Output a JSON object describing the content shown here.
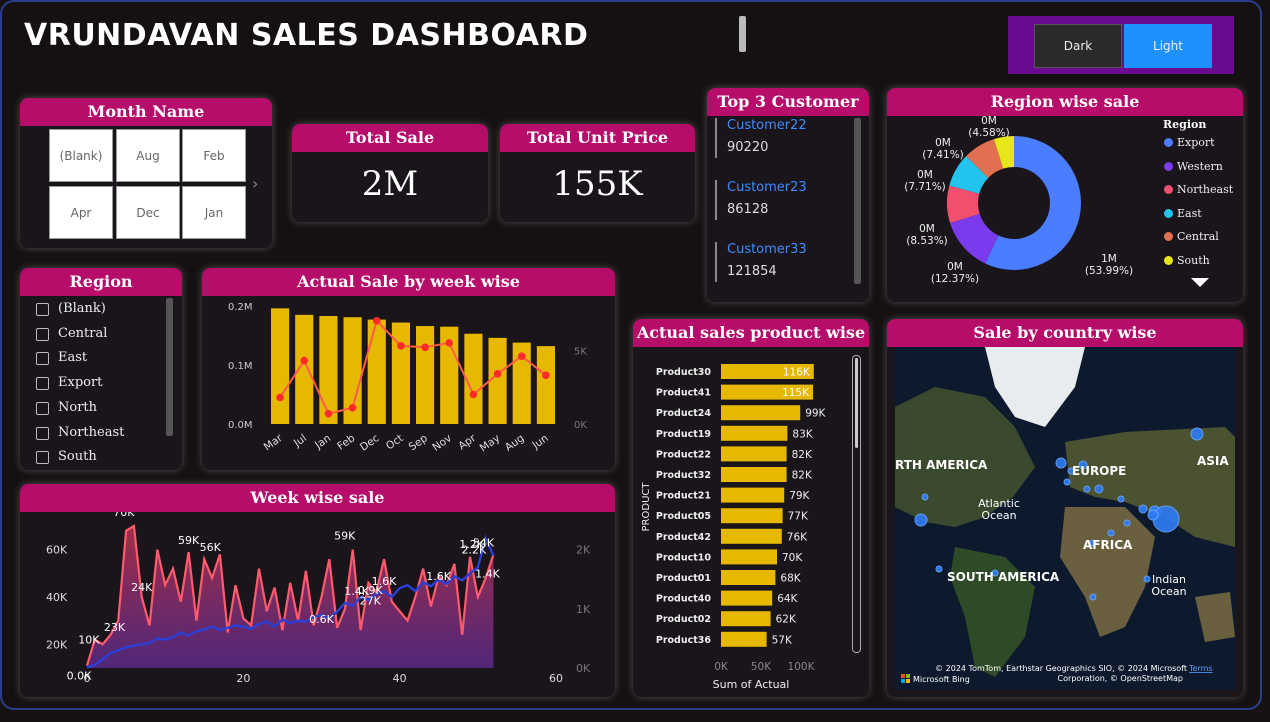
{
  "header": {
    "title": "VRUNDAVAN SALES DASHBOARD"
  },
  "theme_switch": {
    "dark_label": "Dark",
    "light_label": "Light",
    "active": "Light",
    "accent": "#1e90ff",
    "panel_color": "#6a0b8f"
  },
  "colors": {
    "card_title": "#b50d69",
    "bar": "#e6b800",
    "line": "#ff4d4d",
    "accent_blue": "#3d8cff"
  },
  "month_slicer": {
    "title": "Month Name",
    "tiles": [
      "(Blank)",
      "Aug",
      "Feb",
      "Apr",
      "Dec",
      "Jan"
    ]
  },
  "total_sale": {
    "title": "Total Sale",
    "value": "2M"
  },
  "total_unit_price": {
    "title": "Total Unit Price",
    "value": "155K"
  },
  "top_customers": {
    "title": "Top 3 Customer",
    "items": [
      {
        "name": "Customer22",
        "value": "90220"
      },
      {
        "name": "Customer23",
        "value": "86128"
      },
      {
        "name": "Customer33",
        "value": "121854"
      }
    ]
  },
  "region_slicer": {
    "title": "Region",
    "items": [
      "(Blank)",
      "Central",
      "East",
      "Export",
      "North",
      "Northeast",
      "South"
    ]
  },
  "region_wise": {
    "title": "Region wise sale",
    "legend_title": "Region",
    "legend": [
      {
        "name": "Export",
        "color": "#4a7dff"
      },
      {
        "name": "Western",
        "color": "#7c3aed"
      },
      {
        "name": "Northeast",
        "color": "#f0506e"
      },
      {
        "name": "East",
        "color": "#22c4ee"
      },
      {
        "name": "Central",
        "color": "#e07050"
      },
      {
        "name": "South",
        "color": "#e6e619"
      }
    ],
    "labels": [
      {
        "value": "1M",
        "pct": "(53.99%)"
      },
      {
        "value": "0M",
        "pct": "(12.37%)"
      },
      {
        "value": "0M",
        "pct": "(8.53%)"
      },
      {
        "value": "0M",
        "pct": "(7.71%)"
      },
      {
        "value": "0M",
        "pct": "(7.41%)"
      },
      {
        "value": "0M",
        "pct": "(4.58%)"
      }
    ]
  },
  "week_sale_bar": {
    "title": "Actual Sale by week wise"
  },
  "product_wise": {
    "title": "Actual sales product wise",
    "axis_y": "PRODUCT",
    "axis_x": "Sum of Actual"
  },
  "country_map": {
    "title": "Sale by country wise",
    "labels": [
      "RTH AMERICA",
      "EUROPE",
      "ASIA",
      "Atlantic",
      "Ocean",
      "AFRICA",
      "SOUTH AMERICA",
      "Indian",
      "Ocean"
    ],
    "attribution": "© 2024 TomTom, Earthstar Geographics SIO, © 2024 Microsoft",
    "terms": "Terms",
    "corporation": "Corporation, © OpenStreetMap",
    "bing": "Microsoft Bing"
  },
  "week_wise": {
    "title": "Week wise sale"
  },
  "chart_data": [
    {
      "type": "bar",
      "title": "Actual Sale by week wise",
      "categories": [
        "Mar",
        "Jul",
        "Jan",
        "Feb",
        "Dec",
        "Oct",
        "Sep",
        "Nov",
        "Apr",
        "May",
        "Aug",
        "Jun"
      ],
      "series": [
        {
          "type": "bar",
          "values": [
            0.196,
            0.185,
            0.183,
            0.181,
            0.177,
            0.172,
            0.166,
            0.165,
            0.153,
            0.146,
            0.138,
            0.132
          ],
          "axis": "left"
        },
        {
          "type": "line",
          "values": [
            1800,
            4300,
            700,
            1100,
            7000,
            5300,
            5200,
            5500,
            2000,
            3400,
            4600,
            3300
          ],
          "axis": "right"
        }
      ],
      "y_left_ticks": [
        "0.2M",
        "0.1M",
        "0.0M"
      ],
      "y_right_ticks": [
        "5K",
        "0K"
      ],
      "ylim": [
        0,
        0.2
      ],
      "y2lim": [
        0,
        8000
      ]
    },
    {
      "type": "bar",
      "orientation": "horizontal",
      "title": "Actual sales product wise",
      "xlabel": "Sum of Actual",
      "ylabel": "PRODUCT",
      "categories": [
        "Product30",
        "Product41",
        "Product24",
        "Product19",
        "Product22",
        "Product32",
        "Product21",
        "Product05",
        "Product42",
        "Product10",
        "Product01",
        "Product40",
        "Product02",
        "Product36"
      ],
      "values": [
        116,
        115,
        99,
        83,
        82,
        82,
        79,
        77,
        76,
        70,
        68,
        64,
        62,
        57
      ],
      "value_labels": [
        "116K",
        "115K",
        "99K",
        "83K",
        "82K",
        "82K",
        "79K",
        "77K",
        "76K",
        "70K",
        "68K",
        "64K",
        "62K",
        "57K"
      ],
      "x_ticks": [
        "0K",
        "50K",
        "100K"
      ],
      "xlim": [
        0,
        100
      ]
    },
    {
      "type": "area",
      "title": "Week wise sale",
      "x_ticks": [
        "0",
        "20",
        "40",
        "60"
      ],
      "y_left_ticks": [
        "60K",
        "40K",
        "20K"
      ],
      "y_right_ticks": [
        "2K",
        "1K",
        "0K"
      ],
      "xlim": [
        0,
        60
      ],
      "ylim": [
        10000,
        70000
      ],
      "y2lim": [
        0,
        2400
      ],
      "series": [
        {
          "axis": "left",
          "values": [
            11000,
            22000,
            20000,
            24000,
            30000,
            68000,
            70000,
            40000,
            28000,
            60000,
            45000,
            52000,
            38000,
            59000,
            30000,
            56000,
            48000,
            58000,
            25000,
            45000,
            31000,
            28000,
            52000,
            34000,
            44000,
            26000,
            46000,
            30000,
            51000,
            28000,
            40000,
            56000,
            27000,
            35000,
            60000,
            26000,
            46000,
            42000,
            56000,
            38000,
            34000,
            30000,
            40000,
            52000,
            36000,
            49000,
            45000,
            54000,
            24000,
            57000,
            40000,
            48000,
            58000
          ]
        },
        {
          "axis": "right",
          "values": [
            10,
            50,
            150,
            250,
            300,
            350,
            380,
            400,
            420,
            500,
            480,
            520,
            600,
            550,
            620,
            650,
            700,
            640,
            680,
            720,
            700,
            660,
            740,
            780,
            700,
            820,
            760,
            800,
            780,
            860,
            900,
            840,
            950,
            1100,
            1050,
            1200,
            1150,
            1250,
            1300,
            1200,
            1350,
            1400,
            1300,
            1450,
            1380,
            1500,
            1420,
            1550,
            1480,
            1600,
            1700,
            2200,
            1900
          ]
        }
      ],
      "data_labels": [
        {
          "i": 0,
          "text": "0.0K"
        },
        {
          "i": 1,
          "text": "10K"
        },
        {
          "i": 3,
          "text": "23K"
        },
        {
          "i": 7,
          "text": "24K"
        },
        {
          "i": 6,
          "text": "70K"
        },
        {
          "i": 13,
          "text": "59K"
        },
        {
          "i": 15,
          "text": "56K"
        },
        {
          "i": 34,
          "text": "59K"
        },
        {
          "i": 30,
          "text": "0.6K"
        },
        {
          "i": 35,
          "text": "1.4K"
        },
        {
          "i": 38,
          "text": "1.6K"
        },
        {
          "i": 37,
          "text": "0.9K"
        },
        {
          "i": 37,
          "text": "27K"
        },
        {
          "i": 46,
          "text": "1.6K"
        },
        {
          "i": 50,
          "text": "2.2K"
        },
        {
          "i": 51,
          "text": "1.2K"
        },
        {
          "i": 52,
          "text": "54K"
        },
        {
          "i": 52,
          "text": "1.4K"
        }
      ]
    }
  ]
}
